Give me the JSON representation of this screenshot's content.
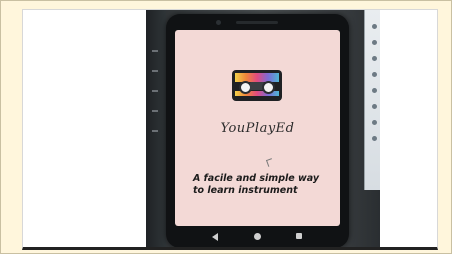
{
  "app": {
    "name": "YouPlayEd",
    "tagline_line1": "A facile and simple way",
    "tagline_line2": "to learn instrument"
  },
  "navigation": {
    "back": "back-icon",
    "home": "home-icon",
    "recent": "recent-apps-icon"
  },
  "colors": {
    "page_background": "#fff7dc",
    "screen_background": "#f3d9d6",
    "icon_background": "#1f2124",
    "icon_bands": [
      "#f2d14b",
      "#f0873a",
      "#e14b7f",
      "#7c6bd6",
      "#4fb6d4"
    ]
  }
}
